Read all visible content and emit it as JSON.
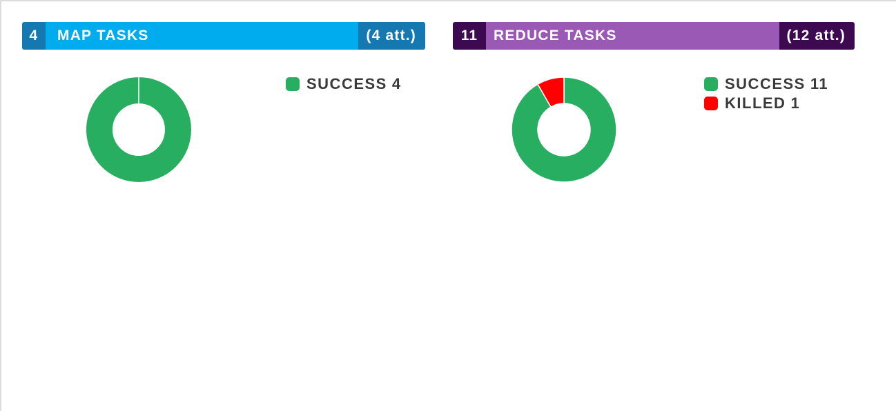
{
  "colors": {
    "success": "#27ae60",
    "killed": "#ff0000",
    "map_main": "#00acee",
    "map_dark": "#1578b0",
    "reduce_main": "#9b59b6",
    "reduce_dark": "#3d0a52"
  },
  "map": {
    "count": "4",
    "title": "MAP TASKS",
    "attempts": "(4 att.)",
    "legend": [
      {
        "label": "SUCCESS",
        "count": "4",
        "value": 4,
        "color": "#27ae60"
      }
    ]
  },
  "reduce": {
    "count": "11",
    "title": "REDUCE TASKS",
    "attempts": "(12 att.)",
    "legend": [
      {
        "label": "SUCCESS",
        "count": "11",
        "value": 11,
        "color": "#27ae60"
      },
      {
        "label": "KILLED",
        "count": "1",
        "value": 1,
        "color": "#ff0000"
      }
    ]
  }
}
